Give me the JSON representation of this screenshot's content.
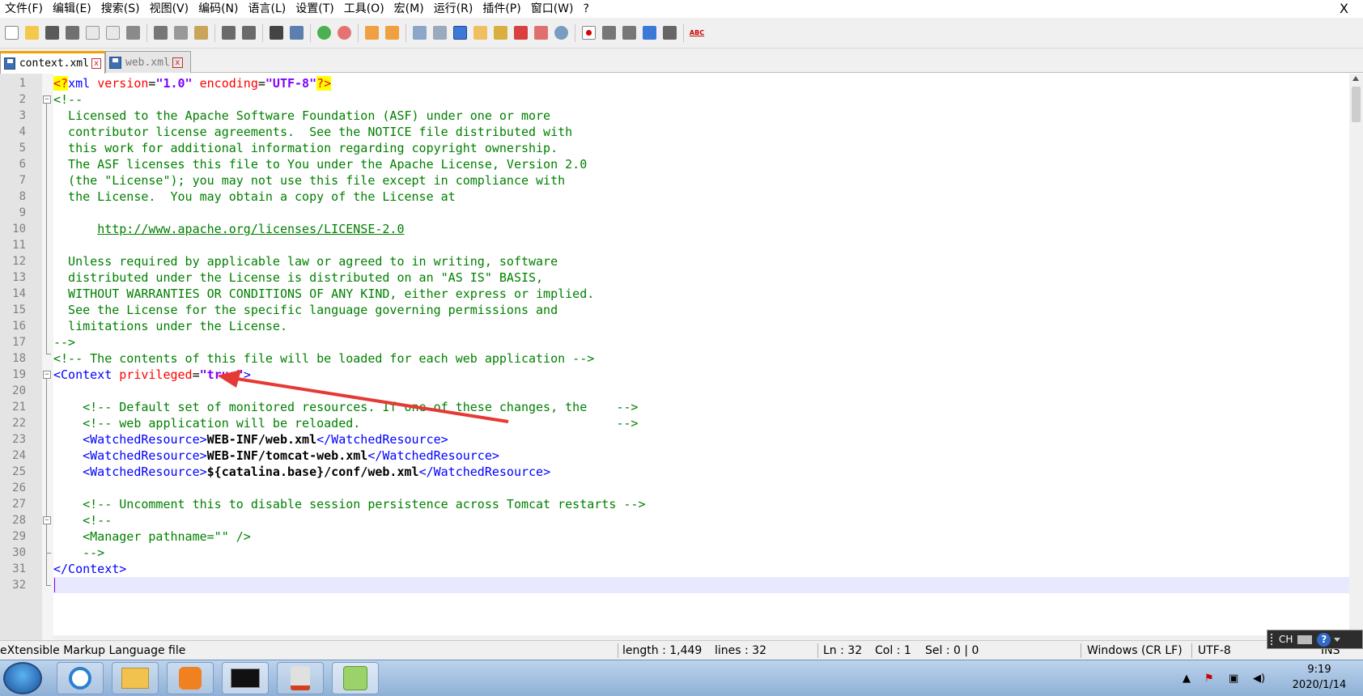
{
  "menu": [
    "文件(F)",
    "编辑(E)",
    "搜索(S)",
    "视图(V)",
    "编码(N)",
    "语言(L)",
    "设置(T)",
    "工具(O)",
    "宏(M)",
    "运行(R)",
    "插件(P)",
    "窗口(W)",
    "?"
  ],
  "menu_close": "X",
  "toolbar_icons": [
    "new-file-icon",
    "open-file-icon",
    "save-icon",
    "save-all-icon",
    "close-icon",
    "close-all-icon",
    "print-icon",
    "cut-icon",
    "copy-icon",
    "paste-icon",
    "undo-icon",
    "redo-icon",
    "find-icon",
    "replace-icon",
    "zoom-in-icon",
    "zoom-out-icon",
    "sync-v-icon",
    "sync-h-icon",
    "word-wrap-icon",
    "all-chars-icon",
    "indent-guide-icon",
    "doc-map-icon",
    "function-list-icon",
    "folder-workspace-icon",
    "monitor-icon",
    "record-macro-icon",
    "stop-record-icon",
    "play-macro-icon",
    "run-macro-multiple-icon",
    "save-macro-icon",
    "spellcheck-icon"
  ],
  "toolbar_spell_label": "ABC",
  "tabs": [
    {
      "label": "context.xml",
      "active": true
    },
    {
      "label": "web.xml",
      "active": false
    }
  ],
  "tab_close_glyph": "x",
  "editor": {
    "line_numbers": [
      "1",
      "2",
      "3",
      "4",
      "5",
      "6",
      "7",
      "8",
      "9",
      "10",
      "11",
      "12",
      "13",
      "14",
      "15",
      "16",
      "17",
      "18",
      "19",
      "20",
      "21",
      "22",
      "23",
      "24",
      "25",
      "26",
      "27",
      "28",
      "29",
      "30",
      "31",
      "32"
    ],
    "lines": {
      "l1": {
        "a": "<?",
        "b": "xml ",
        "c": "version",
        "d": "=",
        "e": "\"1.0\"",
        "f": " encoding",
        "g": "=",
        "h": "\"UTF-8\"",
        "i": "?>"
      },
      "l2": "<!--",
      "l3": "  Licensed to the Apache Software Foundation (ASF) under one or more",
      "l4": "  contributor license agreements.  See the NOTICE file distributed with",
      "l5": "  this work for additional information regarding copyright ownership.",
      "l6": "  The ASF licenses this file to You under the Apache License, Version 2.0",
      "l7": "  (the \"License\"); you may not use this file except in compliance with",
      "l8": "  the License.  You may obtain a copy of the License at",
      "l10_prefix": "      ",
      "l10_link": "http://www.apache.org/licenses/LICENSE-2.0",
      "l12": "  Unless required by applicable law or agreed to in writing, software",
      "l13": "  distributed under the License is distributed on an \"AS IS\" BASIS,",
      "l14": "  WITHOUT WARRANTIES OR CONDITIONS OF ANY KIND, either express or implied.",
      "l15": "  See the License for the specific language governing permissions and",
      "l16": "  limitations under the License.",
      "l17": "-->",
      "l18": "<!-- The contents of this file will be loaded for each web application -->",
      "l19": {
        "a": "<Context ",
        "b": "privileged",
        "c": "=",
        "d": "\"true\"",
        "e": ">"
      },
      "l21": "    <!-- Default set of monitored resources. If one of these changes, the    -->",
      "l22": "    <!-- web application will be reloaded.                                   -->",
      "l23": {
        "a": "    <WatchedResource>",
        "b": "WEB-INF/web.xml",
        "c": "</WatchedResource>"
      },
      "l24": {
        "a": "    <WatchedResource>",
        "b": "WEB-INF/tomcat-web.xml",
        "c": "</WatchedResource>"
      },
      "l25": {
        "a": "    <WatchedResource>",
        "b": "${catalina.base}/conf/web.xml",
        "c": "</WatchedResource>"
      },
      "l27": "    <!-- Uncomment this to disable session persistence across Tomcat restarts -->",
      "l28": "    <!--",
      "l29": "    <Manager pathname=\"\" />",
      "l30": "    -->",
      "l31": "</Context>"
    }
  },
  "status": {
    "filetype": "eXtensible Markup Language file",
    "length": "length : 1,449",
    "lines": "lines : 32",
    "ln": "Ln : 32",
    "col": "Col : 1",
    "sel": "Sel : 0 | 0",
    "eol": "Windows (CR LF)",
    "encoding": "UTF-8",
    "mode": "INS"
  },
  "ime": {
    "lang": "CH"
  },
  "clock": {
    "time": "9:19",
    "date": "2020/1/14"
  },
  "colors": {
    "comment": "#008000",
    "tag": "#0000ff",
    "attr": "#ff0000",
    "value": "#8000ff",
    "annotation_arrow": "#e53935"
  }
}
